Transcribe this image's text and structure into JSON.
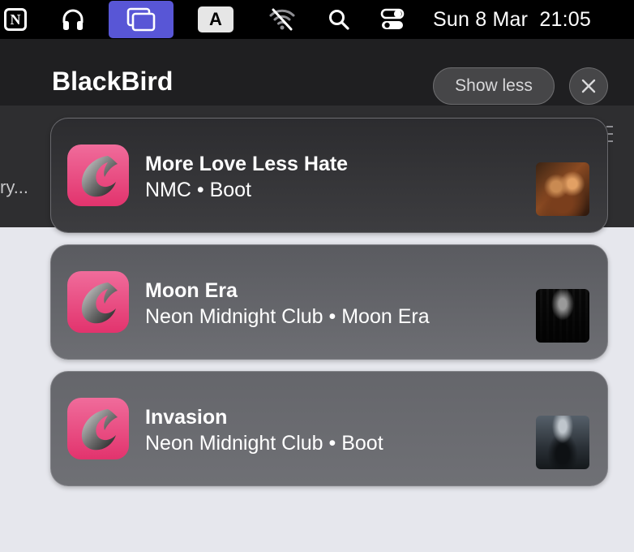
{
  "menubar": {
    "notion_letter": "N",
    "input_source": "A",
    "clock": "Sun 8 Mar  21:05",
    "icons": [
      "notion-icon",
      "headphones-icon",
      "windows-icon",
      "input-source-icon",
      "wifi-off-icon",
      "search-icon",
      "control-center-icon"
    ],
    "accent_color": "#5856d6"
  },
  "panel": {
    "truncated_text": "ry..."
  },
  "notifications": {
    "app_name": "BlackBird",
    "show_less_label": "Show less",
    "close_icon": "close-icon",
    "items": [
      {
        "title": "More Love Less Hate",
        "subtitle": "NMC • Boot"
      },
      {
        "title": "Moon Era",
        "subtitle": "Neon Midnight Club • Moon Era"
      },
      {
        "title": "Invasion",
        "subtitle": "Neon Midnight Club • Boot"
      }
    ],
    "app_icon_color": "#e2336d"
  }
}
